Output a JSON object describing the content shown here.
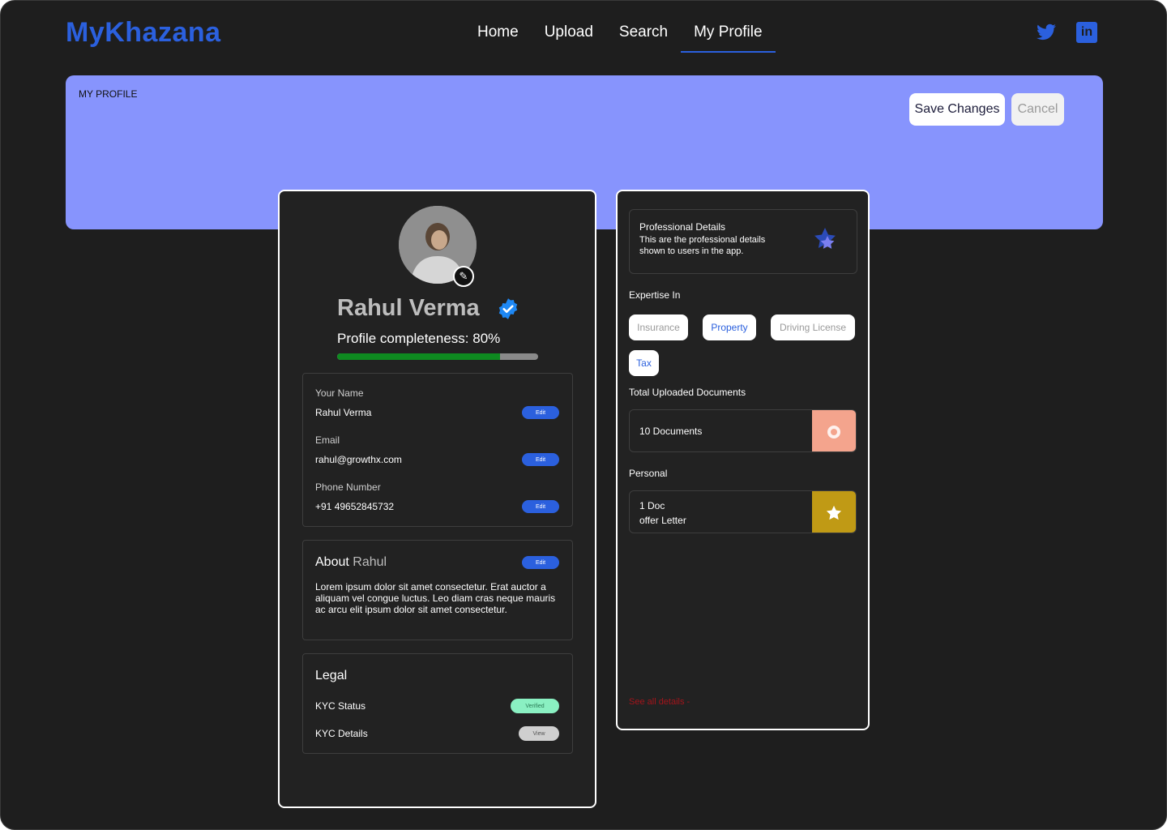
{
  "app": {
    "logo": "MyKhazana"
  },
  "nav": {
    "items": [
      "Home",
      "Upload",
      "Search",
      "My Profile"
    ],
    "active_index": 3
  },
  "social": {
    "twitter_icon": "twitter-icon",
    "linkedin_icon": "linkedin-icon",
    "linkedin_glyph": "in"
  },
  "banner": {
    "title": "MY PROFILE",
    "save_label": "Save Changes",
    "cancel_label": "Cancel"
  },
  "profile": {
    "name": "Rahul Verma",
    "completeness_text": "Profile completeness: 80%",
    "completeness_value": 0.81,
    "details": {
      "name_label": "Your Name",
      "name_value": "Rahul Verma",
      "email_label": "Email",
      "email_value": "rahul@growthx.com",
      "phone_label": "Phone Number",
      "phone_value": "+91 49652845732",
      "edit_label": "Edit"
    },
    "about": {
      "title_prefix": "About",
      "title_name": "Rahul",
      "edit_label": "Edit",
      "text": "Lorem ipsum dolor sit amet consectetur. Erat auctor a aliquam vel congue luctus. Leo diam cras neque mauris ac arcu elit ipsum dolor sit amet consectetur."
    },
    "legal": {
      "title": "Legal",
      "kyc_status_label": "KYC Status",
      "kyc_status_value": "Verified",
      "kyc_details_label": "KYC Details",
      "kyc_details_action": "View"
    }
  },
  "professional": {
    "title": "Professional Details",
    "description": "This are the professional details shown to users in the app.",
    "expertise_label": "Expertise In",
    "expertise": [
      {
        "label": "Insurance",
        "active": false
      },
      {
        "label": "Property",
        "active": true
      },
      {
        "label": "Driving License",
        "active": false
      },
      {
        "label": "Tax",
        "active": true
      }
    ],
    "total_docs_label": "Total Uploaded Documents",
    "total_docs_value": "10 Documents",
    "personal_label": "Personal",
    "personal_count": "1 Doc",
    "personal_doc": "offer Letter",
    "see_all": "See all details -"
  },
  "colors": {
    "accent": "#2b60de",
    "banner": "#8794fd",
    "progress": "#0e8a20",
    "docs_tile": "#f4a48d",
    "personal_tile": "#c09a15",
    "see_all": "#a4141b",
    "verified_pill": "#8af0c2"
  }
}
